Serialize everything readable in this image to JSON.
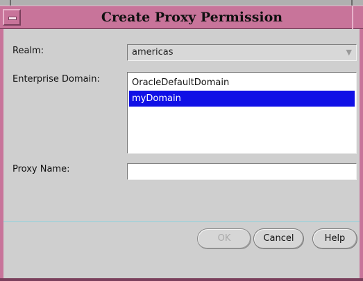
{
  "dialog": {
    "title": "Create Proxy Permission"
  },
  "form": {
    "realm": {
      "label": "Realm:",
      "value": "americas"
    },
    "enterprise_domain": {
      "label": "Enterprise Domain:",
      "options": [
        "OracleDefaultDomain",
        "myDomain"
      ],
      "selected": "myDomain"
    },
    "proxy_name": {
      "label": "Proxy Name:",
      "value": ""
    }
  },
  "buttons": {
    "ok": "OK",
    "cancel": "Cancel",
    "help": "Help"
  },
  "colors": {
    "title_bar": "#c8749a",
    "selection": "#1010e6",
    "background": "#cfcfcf"
  },
  "icons": {
    "window_menu": "window-menu-icon",
    "combo_arrow": "chevron-down-icon"
  }
}
